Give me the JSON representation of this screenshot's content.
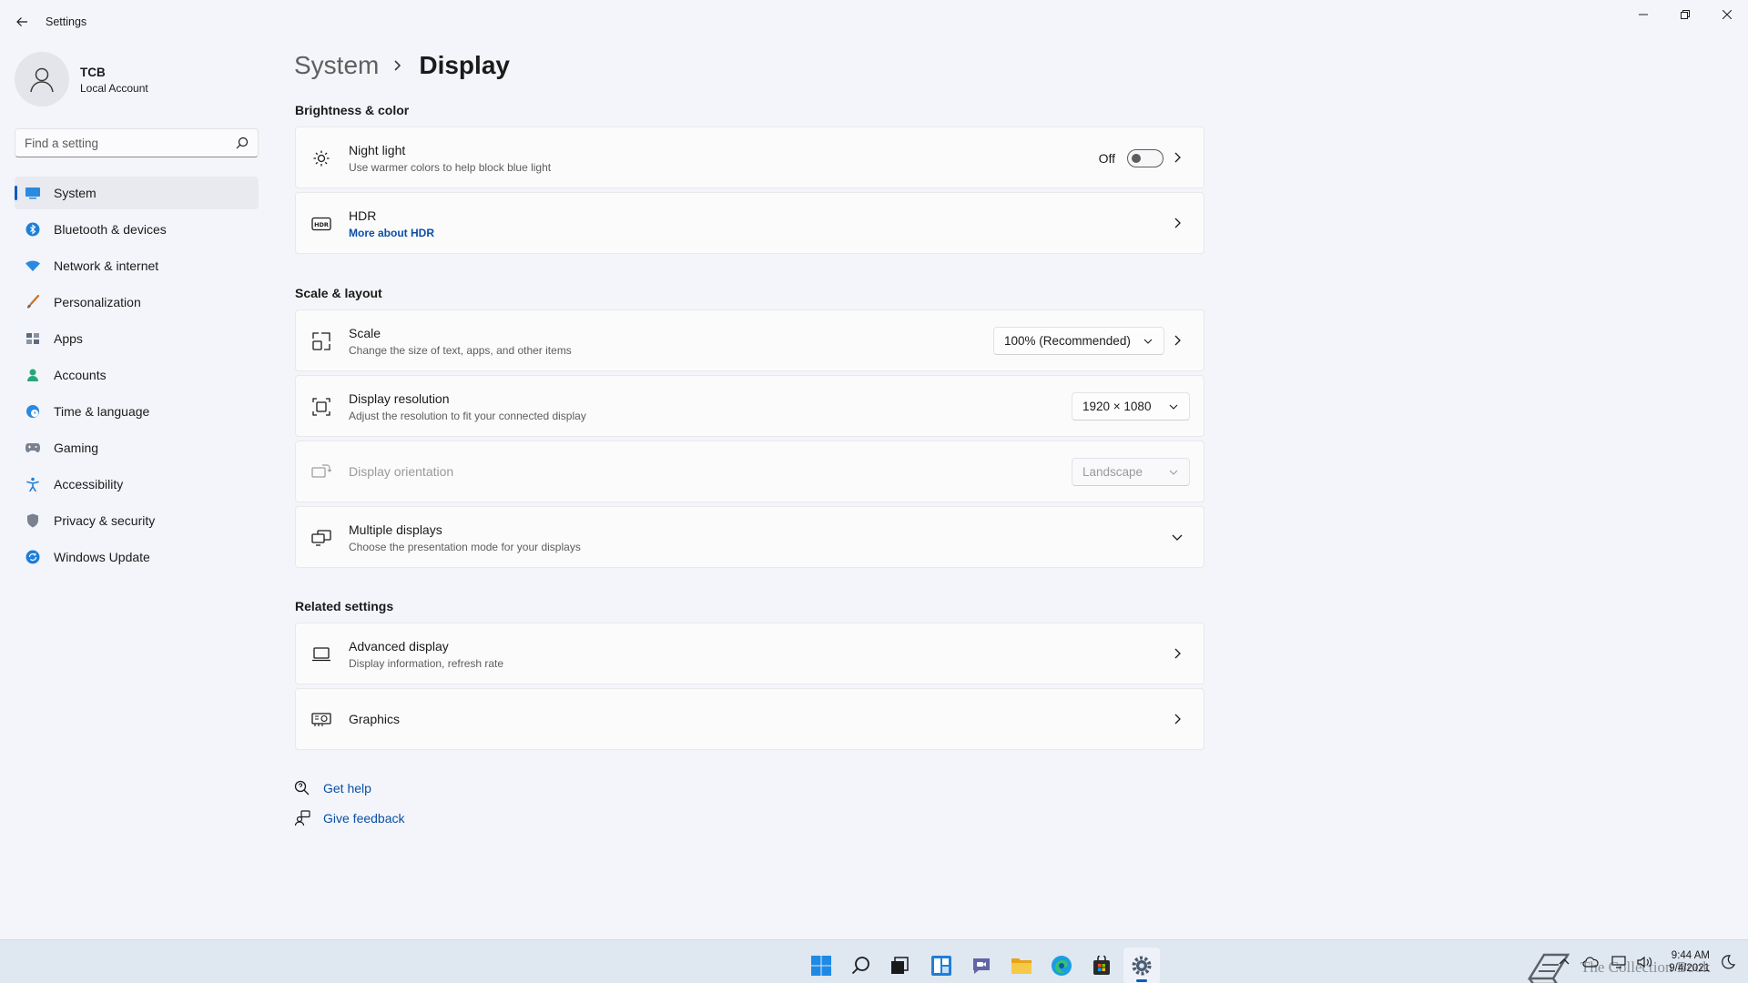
{
  "window": {
    "title": "Settings"
  },
  "profile": {
    "name": "TCB",
    "account_type": "Local Account"
  },
  "search": {
    "placeholder": "Find a setting"
  },
  "sidebar": {
    "items": [
      {
        "label": "System",
        "icon": "monitor-icon",
        "active": true
      },
      {
        "label": "Bluetooth & devices",
        "icon": "bluetooth-icon"
      },
      {
        "label": "Network & internet",
        "icon": "wifi-icon"
      },
      {
        "label": "Personalization",
        "icon": "brush-icon"
      },
      {
        "label": "Apps",
        "icon": "apps-icon"
      },
      {
        "label": "Accounts",
        "icon": "person-icon"
      },
      {
        "label": "Time & language",
        "icon": "globe-clock-icon"
      },
      {
        "label": "Gaming",
        "icon": "gamepad-icon"
      },
      {
        "label": "Accessibility",
        "icon": "accessibility-icon"
      },
      {
        "label": "Privacy & security",
        "icon": "shield-icon"
      },
      {
        "label": "Windows Update",
        "icon": "update-icon"
      }
    ]
  },
  "breadcrumb": {
    "parent": "System",
    "current": "Display"
  },
  "sections": {
    "brightness": "Brightness & color",
    "scale_layout": "Scale & layout",
    "related": "Related settings"
  },
  "cards": {
    "night_light": {
      "title": "Night light",
      "subtitle": "Use warmer colors to help block blue light",
      "toggle_state": "Off"
    },
    "hdr": {
      "title": "HDR",
      "link": "More about HDR"
    },
    "scale": {
      "title": "Scale",
      "subtitle": "Change the size of text, apps, and other items",
      "value": "100% (Recommended)"
    },
    "resolution": {
      "title": "Display resolution",
      "subtitle": "Adjust the resolution to fit your connected display",
      "value": "1920 × 1080"
    },
    "orientation": {
      "title": "Display orientation",
      "value": "Landscape"
    },
    "multiple": {
      "title": "Multiple displays",
      "subtitle": "Choose the presentation mode for your displays"
    },
    "advanced": {
      "title": "Advanced display",
      "subtitle": "Display information, refresh rate"
    },
    "graphics": {
      "title": "Graphics"
    }
  },
  "help": {
    "get_help": "Get help",
    "feedback": "Give feedback"
  },
  "taskbar": {
    "apps": [
      "start-icon",
      "search-icon",
      "task-view-icon",
      "widgets-icon",
      "chat-icon",
      "file-explorer-icon",
      "edge-icon",
      "store-icon",
      "settings-icon"
    ],
    "time": "9:44 AM",
    "date": "9/4/2021"
  },
  "watermark": {
    "text": "The Collection Book"
  },
  "colors": {
    "accent": "#0a5cbe",
    "link": "#0a4fa6",
    "background": "#f3f5fa",
    "card": "#fbfbfc"
  }
}
